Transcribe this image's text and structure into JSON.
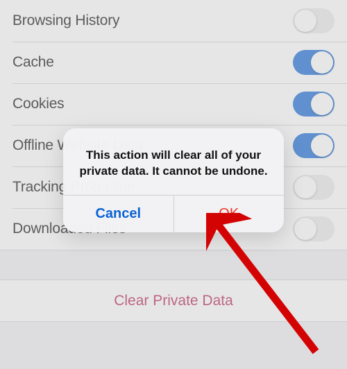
{
  "rows": [
    {
      "label": "Browsing History",
      "on": false
    },
    {
      "label": "Cache",
      "on": true
    },
    {
      "label": "Cookies",
      "on": true
    },
    {
      "label": "Offline Website Data",
      "on": true
    },
    {
      "label": "Tracking Protection",
      "on": false
    },
    {
      "label": "Downloaded Files",
      "on": false
    }
  ],
  "action": {
    "label": "Clear Private Data"
  },
  "alert": {
    "message": "This action will clear all of your private data. It cannot be undone.",
    "cancel": "Cancel",
    "ok": "OK"
  }
}
